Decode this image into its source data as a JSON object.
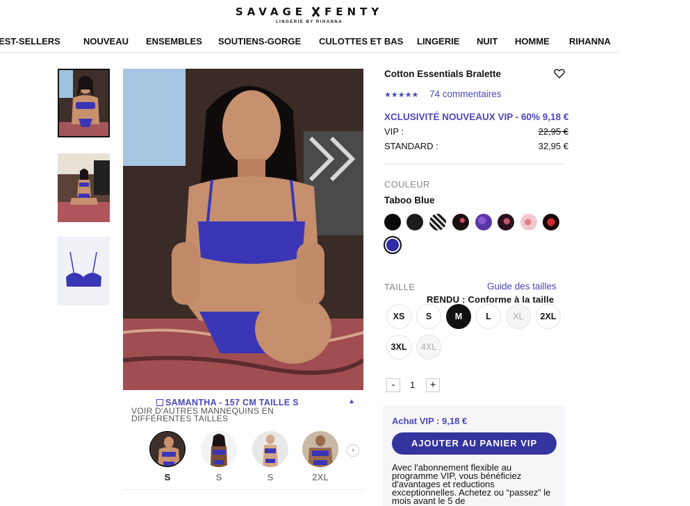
{
  "brand": {
    "name_left": "SAVAGE",
    "name_right": "FENTY",
    "tagline": "LINGERIE BY RIHANNA"
  },
  "nav": [
    "EST-SELLERS",
    "NOUVEAU",
    "ENSEMBLES",
    "SOUTIENS-GORGE",
    "CULOTTES ET BAS",
    "LINGERIE",
    "NUIT",
    "HOMME",
    "RIHANNA"
  ],
  "colors": {
    "accent": "#4a48b8",
    "button": "#34349e",
    "product_blue": "#3a35b5"
  },
  "model_panel": {
    "title": "SAMANTHA - 157 CM TAILLE S",
    "subtitle": "VOIR D'AUTRES MANNEQUINS EN DIFFÉRENTES TAILLES",
    "models": [
      {
        "size": "S",
        "active": true
      },
      {
        "size": "S",
        "active": false
      },
      {
        "size": "S",
        "active": false
      },
      {
        "size": "2XL",
        "active": false
      }
    ]
  },
  "product": {
    "title": "Cotton Essentials Bralette",
    "stars": "★★★★★",
    "reviews": "74 commentaires",
    "promo": "XCLUSIVITÉ NOUVEAUX VIP - 60% 9,18 €",
    "vip_label": "VIP :",
    "vip_price": "22,95 €",
    "standard_label": "STANDARD :",
    "standard_price": "32,95 €"
  },
  "color_section": {
    "label": "COULEUR",
    "selected": "Taboo Blue",
    "swatches": [
      {
        "name": "black",
        "color": "#0a0a0a"
      },
      {
        "name": "black-texture",
        "color": "#1c1c1c"
      },
      {
        "name": "zebra-print",
        "color": "#d8d8d8"
      },
      {
        "name": "black-floral",
        "color": "#1a1010"
      },
      {
        "name": "purple-print",
        "color": "#5b36a8"
      },
      {
        "name": "dark-floral",
        "color": "#2a1020"
      },
      {
        "name": "pink-print",
        "color": "#f0c8cf"
      },
      {
        "name": "red-black-print",
        "color": "#1a0808"
      },
      {
        "name": "taboo-blue",
        "color": "#2e2aa8"
      }
    ]
  },
  "size_section": {
    "label": "TAILLE",
    "guide": "Guide des tailles",
    "fit": "RENDU : Conforme à la taille",
    "sizes": [
      "XS",
      "S",
      "M",
      "L",
      "XL",
      "2XL",
      "3XL",
      "4XL"
    ],
    "selected": "M",
    "unavailable": [
      "XL",
      "4XL"
    ]
  },
  "quantity": {
    "minus": "-",
    "value": "1",
    "plus": "+"
  },
  "vip_box": {
    "price_text": "Achat VIP : 9,18 €",
    "button": "AJOUTER AU PANIER VIP",
    "description": "Avec l'abonnement flexible au programme VIP, vous bénéficiez d'avantages et reductions exceptionnelles. Achetez ou “passez” le mois avant le 5 de"
  }
}
